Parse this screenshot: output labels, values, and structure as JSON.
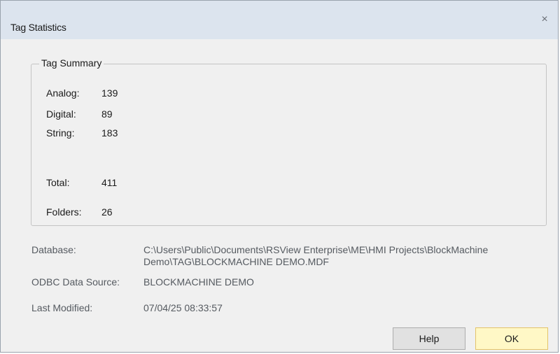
{
  "dialog": {
    "title": "Tag Statistics",
    "close_glyph": "×"
  },
  "summary": {
    "legend": "Tag Summary",
    "analog_label": "Analog:",
    "analog_value": "139",
    "digital_label": "Digital:",
    "digital_value": "89",
    "string_label": "String:",
    "string_value": "183",
    "total_label": "Total:",
    "total_value": "411",
    "folders_label": "Folders:",
    "folders_value": "26"
  },
  "info": {
    "database_label": "Database:",
    "database_value": "C:\\Users\\Public\\Documents\\RSView Enterprise\\ME\\HMI Projects\\BlockMachine Demo\\TAG\\BLOCKMACHINE DEMO.MDF",
    "odbc_label": "ODBC Data Source:",
    "odbc_value": "BLOCKMACHINE DEMO",
    "modified_label": "Last Modified:",
    "modified_value": "07/04/25 08:33:57"
  },
  "buttons": {
    "help": "Help",
    "ok": "OK"
  },
  "colors": {
    "titlebar": "#dce4ee",
    "dialog_bg": "#f0f0f0",
    "ok_button": "#fff8c6",
    "ok_border": "#e3c36a"
  }
}
